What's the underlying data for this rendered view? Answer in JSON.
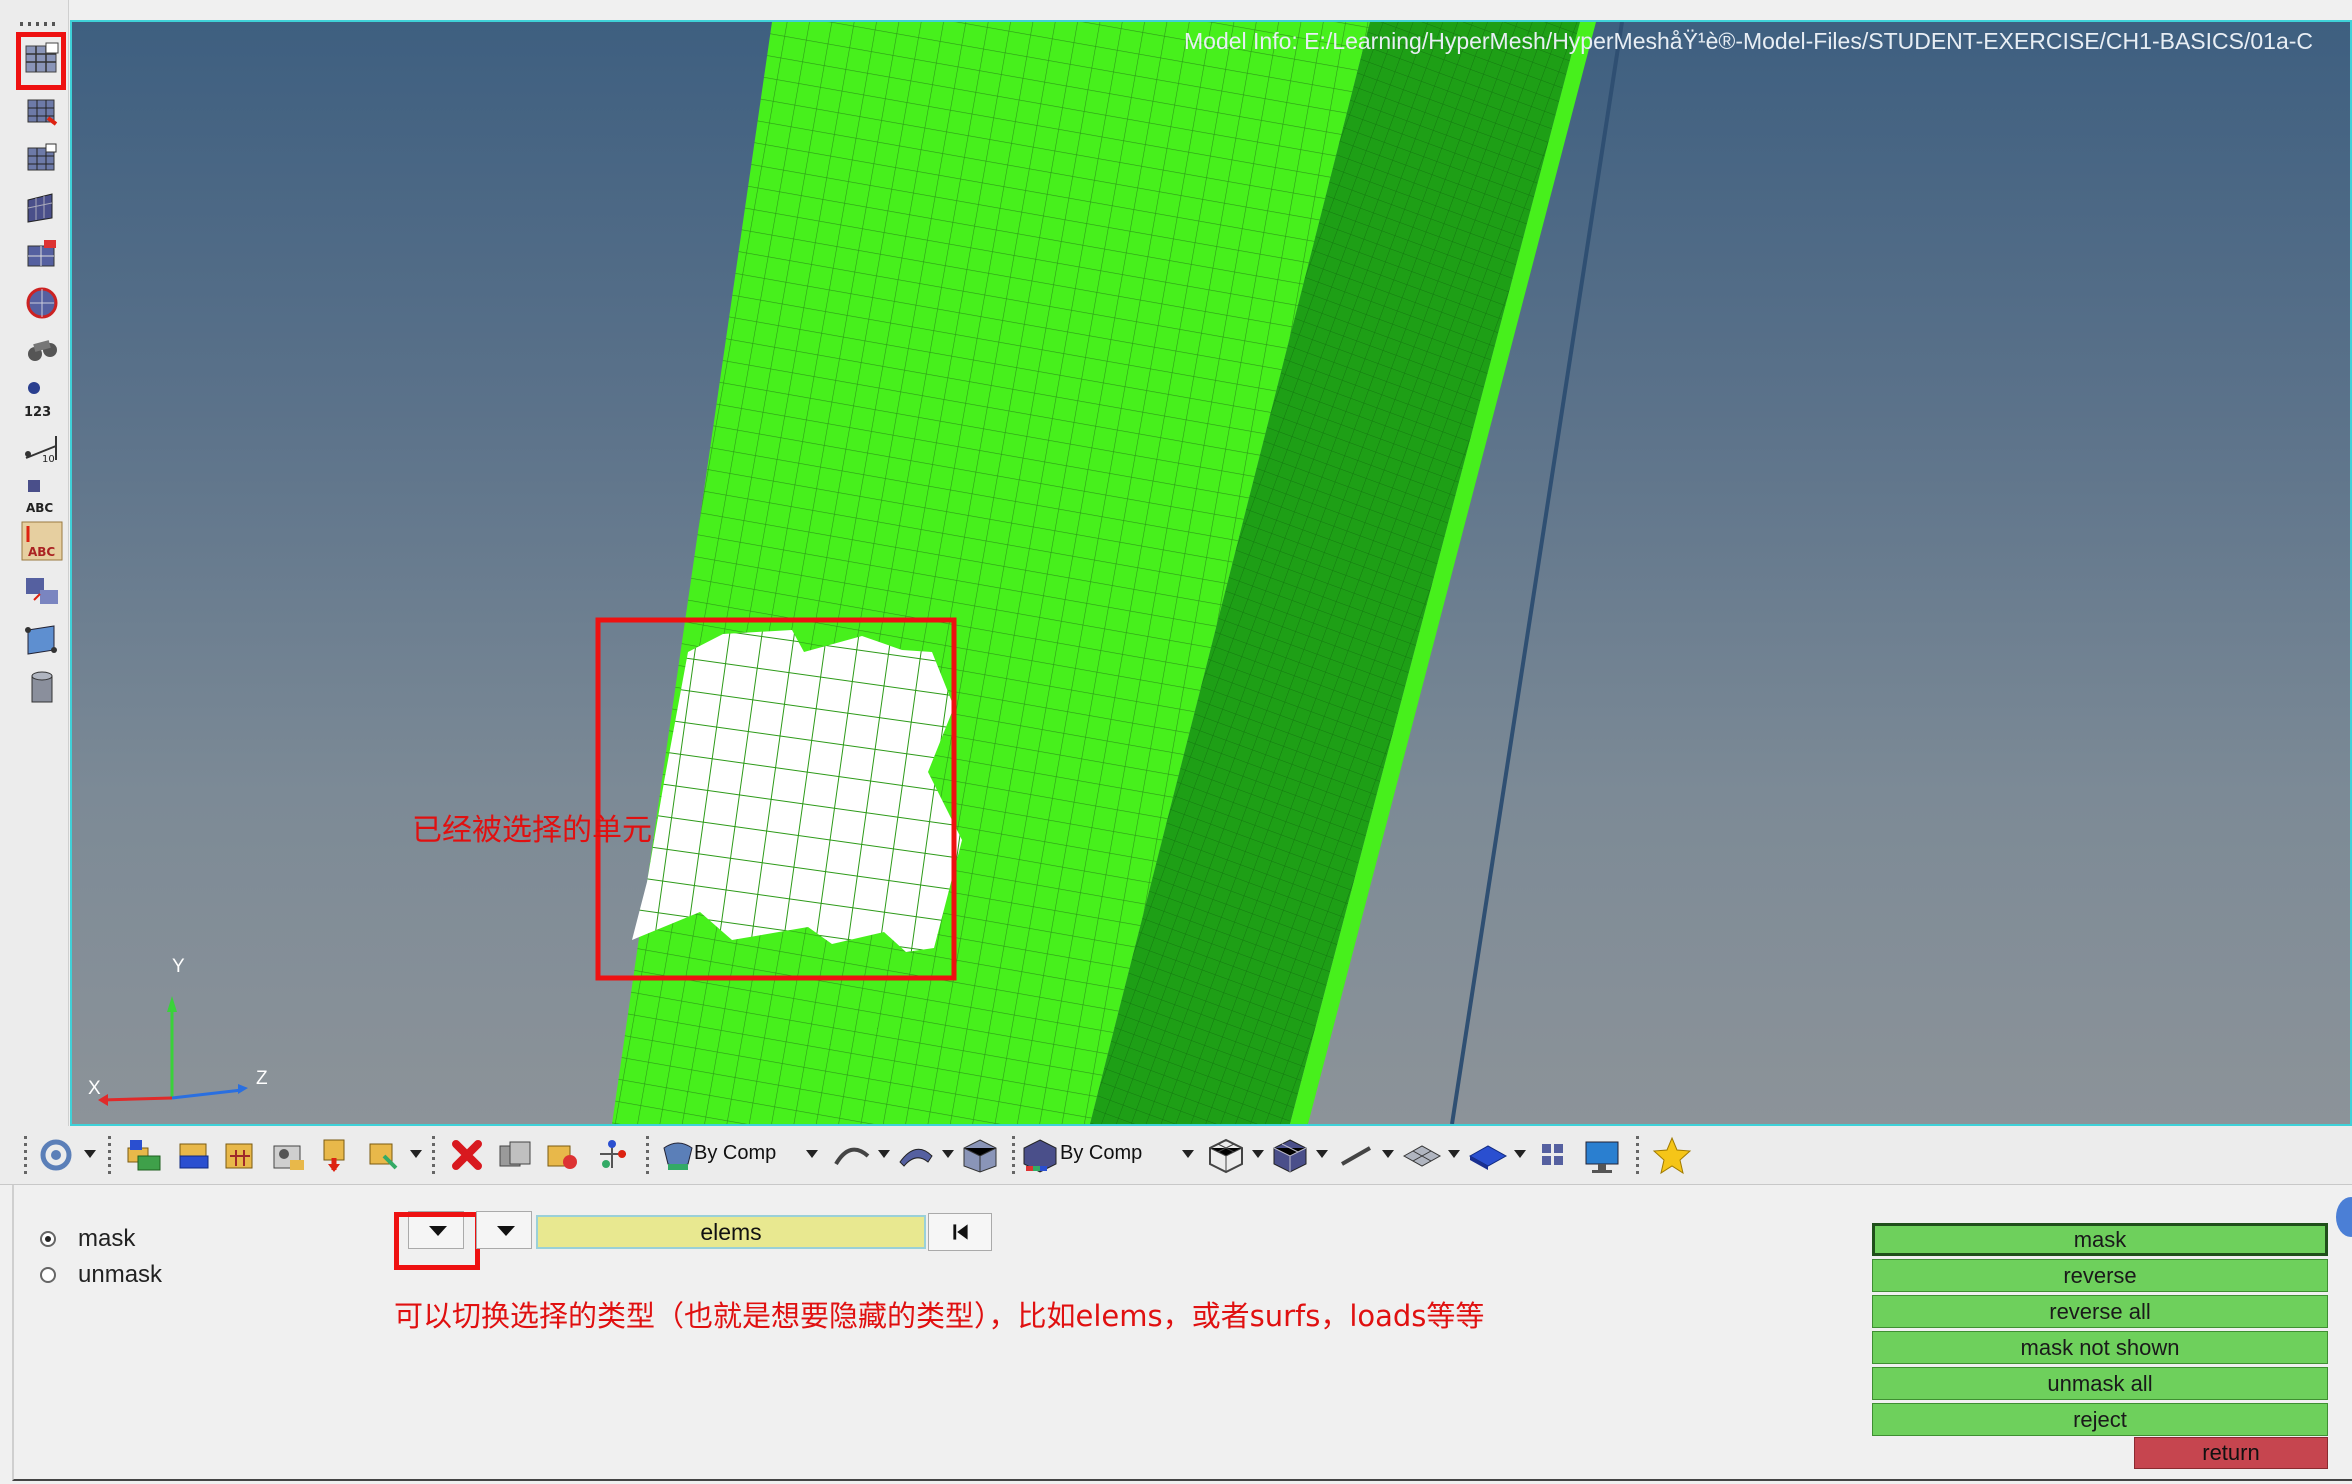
{
  "viewport": {
    "model_info": "Model Info: E:/Learning/HyperMesh/HyperMeshåŸ¹è®­-Model-Files/STUDENT-EXERCISE/CH1-BASICS/01a-C",
    "axes": {
      "y": "Y",
      "x": "X",
      "z": "Z"
    },
    "annotation_selected": "已经被选择的单元"
  },
  "left_toolbar": {
    "icons": [
      "mask-panel-icon",
      "find-icon",
      "view-icon",
      "shaded-elements-icon",
      "mesh-display-icon",
      "globe-icon",
      "binoculars-icon",
      "numbers-icon",
      "distance-icon",
      "abc-label-icon",
      "abc-label-2-icon",
      "transform-icon",
      "plane-icon",
      "cylinder-icon"
    ]
  },
  "bottom_toolbar": {
    "color_mode_1": "By Comp",
    "color_mode_2": "By Comp"
  },
  "panel": {
    "mode_options": [
      "mask",
      "unmask"
    ],
    "selected_mode": "mask",
    "entity_type": "elems",
    "annotation_type": "可以切换选择的类型（也就是想要隐藏的类型），比如elems，或者surfs，loads等等",
    "buttons": [
      "mask",
      "reverse",
      "reverse all",
      "mask not shown",
      "unmask all",
      "reject"
    ],
    "return_label": "return"
  },
  "colors": {
    "mesh_green": "#47f01c",
    "mesh_dark_green": "#1e9f16",
    "selected_white": "#ffffff",
    "highlight_red": "#ee1111",
    "button_green": "#6ed05c",
    "return_red": "#c6454f"
  }
}
